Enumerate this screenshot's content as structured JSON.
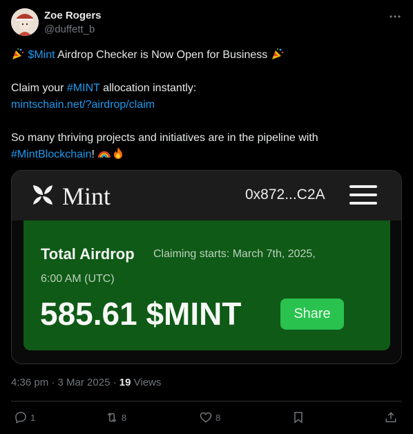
{
  "author": {
    "name": "Zoe Rogers",
    "handle": "@duffett_b"
  },
  "tweet": {
    "line1": {
      "ticker_link": "$Mint",
      "text": " Airdrop Checker is Now Open for Business "
    },
    "line2": {
      "prefix": "Claim your ",
      "hashtag": "#MINT",
      "suffix": " allocation instantly:"
    },
    "line3": {
      "url": "mintschain.net/?airdrop/claim"
    },
    "line4": {
      "text": "So many thriving projects and initiatives are in the pipeline with"
    },
    "line5": {
      "hashtag": "#MintBlockchain",
      "suffix": "!"
    }
  },
  "media": {
    "logo_text": "Mint",
    "wallet": "0x872...C2A",
    "card_title": "Total Airdrop",
    "card_subtitle_1": "Claiming starts: March 7th, 2025,",
    "card_subtitle_2": "6:00 AM (UTC)",
    "amount": "585.61 $MINT",
    "share_label": "Share",
    "colors": {
      "card": "#0f5a16",
      "share_button": "#29c24f"
    }
  },
  "meta": {
    "time": "4:36 pm",
    "date": "3 Mar 2025",
    "views_count": "19",
    "views_label": "Views"
  },
  "actions": {
    "replies": "1",
    "reposts": "8",
    "likes": "8"
  },
  "colors": {
    "link": "#1d9bf0",
    "text": "#e7e9ea",
    "muted": "#71767b"
  }
}
